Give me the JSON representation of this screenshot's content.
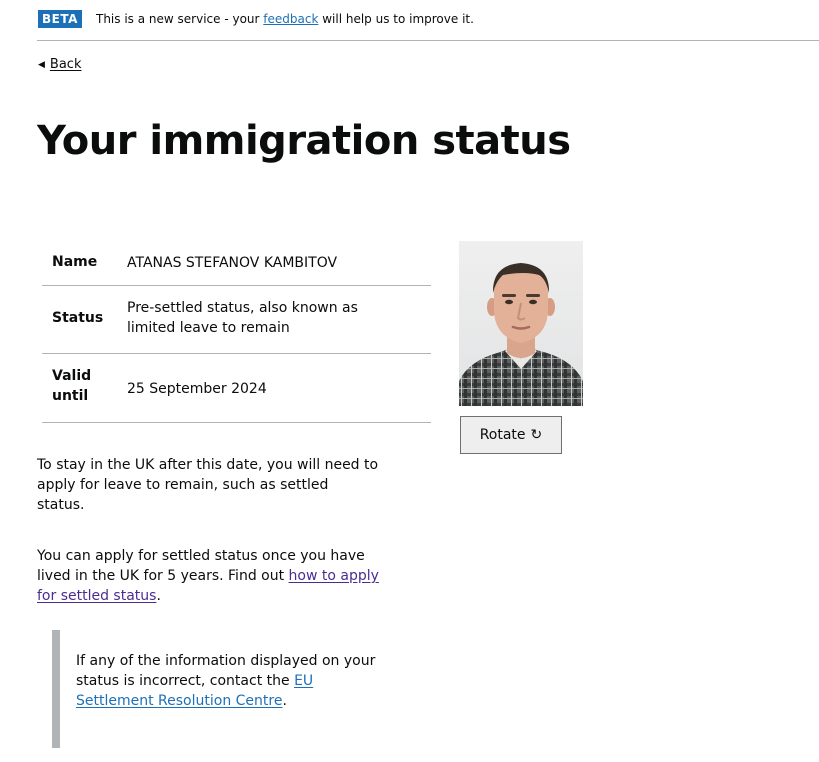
{
  "banner": {
    "tag": "BETA",
    "text_before": "This is a new service - your ",
    "link_text": "feedback",
    "text_after": " will help us to improve it."
  },
  "back_link": {
    "label": "Back"
  },
  "page_title": "Your immigration status",
  "summary": {
    "name": {
      "key": "Name",
      "value": "ATANAS STEFANOV KAMBITOV"
    },
    "status": {
      "key": "Status",
      "value_line1": "Pre-settled status, also known as",
      "value_line2": "limited leave to remain"
    },
    "valid_until": {
      "key_line1": "Valid",
      "key_line2": "until",
      "value": "25 September 2024"
    }
  },
  "photo": {
    "alt": "Photo of ATANAS STEFANOV KAMBITOV"
  },
  "rotate_button": {
    "label": "Rotate",
    "icon_glyph": "↻",
    "icon": "rotate-clockwise-icon"
  },
  "paragraph1": {
    "line1": "To stay in the UK after this date, you will need to",
    "line2": "apply for leave to remain, such as settled",
    "line3": "status."
  },
  "paragraph2": {
    "line1": "You can apply for settled status once you have",
    "line2_before": "lived in the UK for 5 years. Find out ",
    "line2_link": "how to apply",
    "line3_link": "for settled status",
    "line3_after": "."
  },
  "inset": {
    "line1": "If any of the information displayed on your",
    "line2_before": "status is incorrect, contact the ",
    "line2_link": "EU",
    "line3_link": "Settlement Resolution Centre",
    "line3_after": "."
  },
  "colors": {
    "link": "#1d70b8",
    "visited_link": "#4c2c92",
    "text": "#0b0c0c",
    "border": "#b1b4b6",
    "tag_background": "#1d70b8"
  }
}
